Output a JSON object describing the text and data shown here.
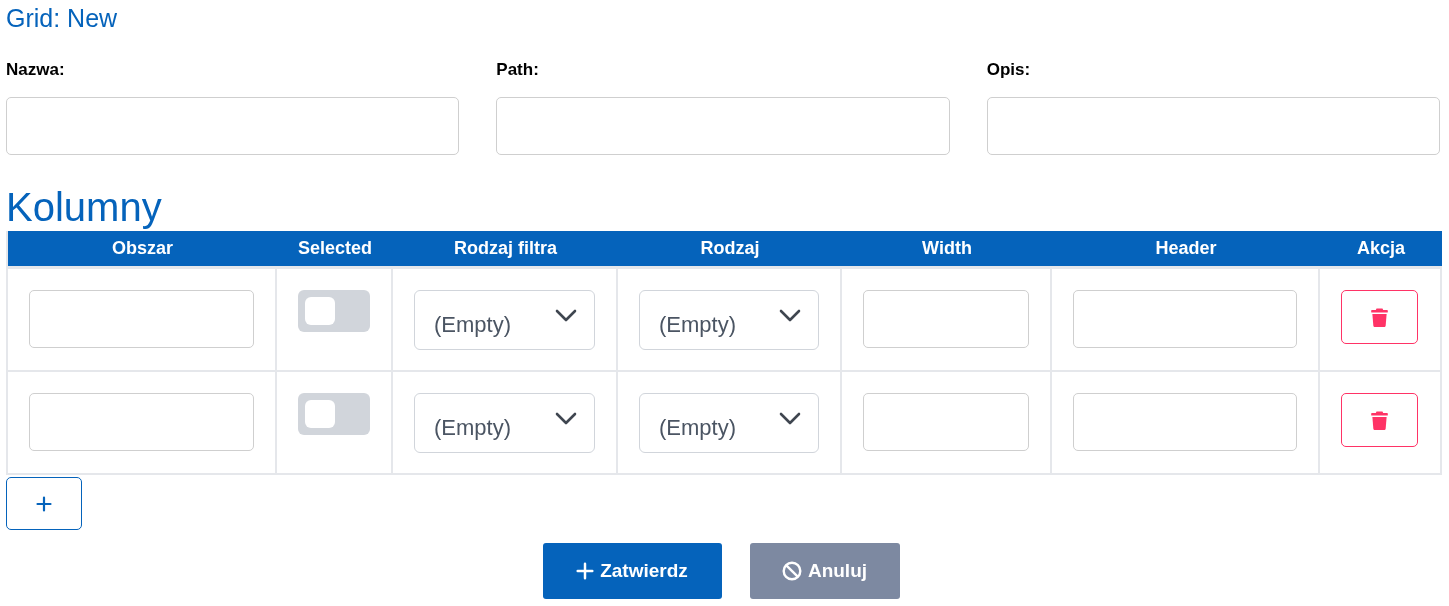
{
  "title": "Grid: New",
  "fields": [
    {
      "label": "Nazwa:"
    },
    {
      "label": "Path:"
    },
    {
      "label": "Opis:"
    }
  ],
  "section_title": "Kolumny",
  "table": {
    "columns": [
      "Obszar",
      "Selected",
      "Rodzaj filtra",
      "Rodzaj",
      "Width",
      "Header",
      "Akcja"
    ],
    "rows": [
      {
        "selected_on": false,
        "rodzaj_filtra": "(Empty)",
        "rodzaj": "(Empty)"
      },
      {
        "selected_on": false,
        "rodzaj_filtra": "(Empty)",
        "rodzaj": "(Empty)"
      }
    ]
  },
  "buttons": [
    {
      "kind": "submit",
      "label": "Zatwierdz"
    },
    {
      "kind": "cancel",
      "label": "Anuluj"
    }
  ]
}
